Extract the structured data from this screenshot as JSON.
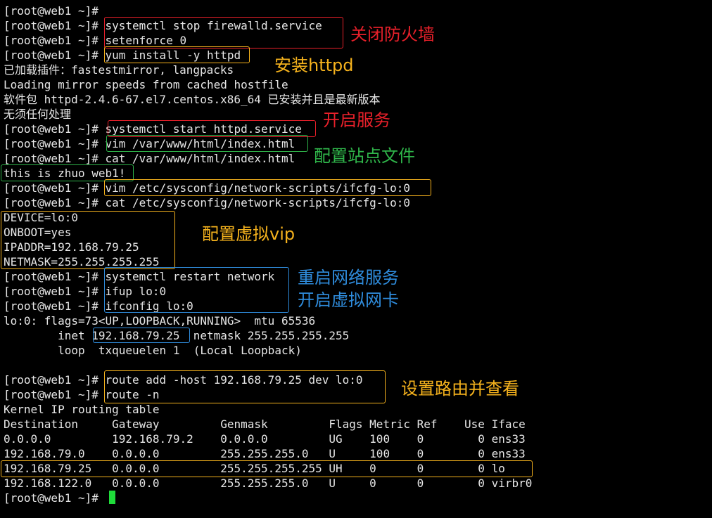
{
  "lines": [
    "[root@web1 ~]#",
    "[root@web1 ~]# systemctl stop firewalld.service",
    "[root@web1 ~]# setenforce 0",
    "[root@web1 ~]# yum install -y httpd",
    "已加载插件：fastestmirror, langpacks",
    "Loading mirror speeds from cached hostfile",
    "软件包 httpd-2.4.6-67.el7.centos.x86_64 已安装并且是最新版本",
    "无须任何处理",
    "[root@web1 ~]# systemctl start httpd.service",
    "[root@web1 ~]# vim /var/www/html/index.html",
    "[root@web1 ~]# cat /var/www/html/index.html",
    "this is zhuo web1!",
    "[root@web1 ~]# vim /etc/sysconfig/network-scripts/ifcfg-lo:0",
    "[root@web1 ~]# cat /etc/sysconfig/network-scripts/ifcfg-lo:0",
    "DEVICE=lo:0",
    "ONBOOT=yes",
    "IPADDR=192.168.79.25",
    "NETMASK=255.255.255.255",
    "[root@web1 ~]# systemctl restart network",
    "[root@web1 ~]# ifup lo:0",
    "[root@web1 ~]# ifconfig lo:0",
    "lo:0: flags=73<UP,LOOPBACK,RUNNING>  mtu 65536",
    "        inet 192.168.79.25  netmask 255.255.255.255",
    "        loop  txqueuelen 1  (Local Loopback)",
    "",
    "[root@web1 ~]# route add -host 192.168.79.25 dev lo:0",
    "[root@web1 ~]# route -n",
    "Kernel IP routing table",
    "Destination     Gateway         Genmask         Flags Metric Ref    Use Iface",
    "0.0.0.0         192.168.79.2    0.0.0.0         UG    100    0        0 ens33",
    "192.168.79.0    0.0.0.0         255.255.255.0   U     100    0        0 ens33",
    "192.168.79.25   0.0.0.0         255.255.255.255 UH    0      0        0 lo",
    "192.168.122.0   0.0.0.0         255.255.255.0   U     0      0        0 virbr0",
    "[root@web1 ~]# "
  ],
  "annotations": {
    "firewall": "关闭防火墙",
    "install_httpd": "安装httpd",
    "start_service": "开启服务",
    "site_file": "配置站点文件",
    "vip": "配置虚拟vip",
    "restart_network": "重启网络服务",
    "virtual_nic": "开启虚拟网卡",
    "route": "设置路由并查看"
  },
  "colors": {
    "background": "#000000",
    "text": "#e6e6e6",
    "red": "#e8202a",
    "orange": "#f5b21d",
    "green": "#2fb54a",
    "blue": "#2f8cdc",
    "cursor": "#1fdc3a"
  }
}
